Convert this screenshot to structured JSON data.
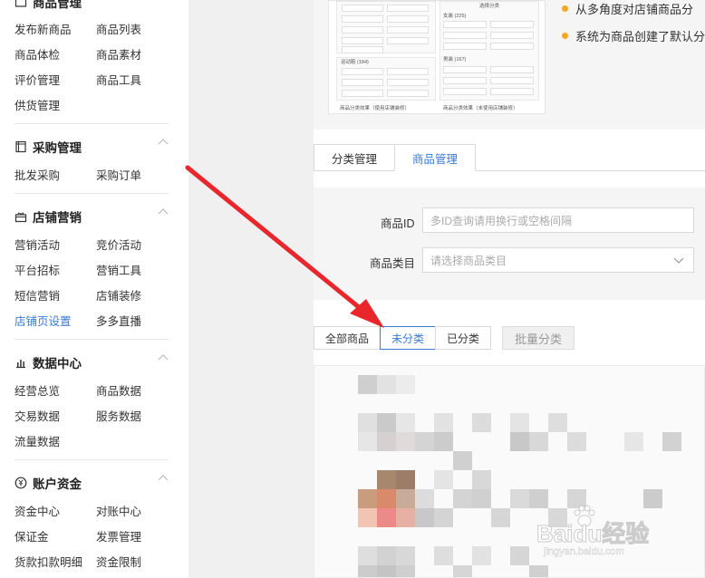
{
  "sidebar": {
    "goods": {
      "title": "商品管理",
      "items": [
        "发布新商品",
        "商品列表",
        "商品体检",
        "商品素材",
        "评价管理",
        "商品工具",
        "供货管理"
      ]
    },
    "purchase": {
      "title": "采购管理",
      "items": [
        "批发采购",
        "采购订单"
      ]
    },
    "marketing": {
      "title": "店铺营销",
      "items": [
        "营销活动",
        "竞价活动",
        "平台招标",
        "营销工具",
        "短信营销",
        "店铺装修",
        "店铺页设置",
        "多多直播"
      ],
      "active": "店铺页设置"
    },
    "data": {
      "title": "数据中心",
      "items": [
        "经营总览",
        "商品数据",
        "交易数据",
        "服务数据",
        "流量数据"
      ]
    },
    "finance": {
      "title": "账户资金",
      "items": [
        "资金中心",
        "对账中心",
        "保证金",
        "发票管理",
        "货款扣款明细",
        "资金限制"
      ]
    }
  },
  "preview": {
    "left_caption": "商品分类效果（使用店铺装修）",
    "right_caption": "商品分类效果（未使用店铺装修）",
    "right_top_label": "选择分类",
    "group1": "女装 (225)",
    "group2": "男装 (167)",
    "group3": "运动鞋 (184)"
  },
  "bullets": [
    "从多角度对店铺商品分",
    "系统为商品创建了默认分"
  ],
  "tabs": {
    "category": "分类管理",
    "goods": "商品管理"
  },
  "form": {
    "id_label": "商品ID",
    "id_placeholder": "多ID查询请用换行或空格间隔",
    "category_label": "商品类目",
    "category_placeholder": "请选择商品类目"
  },
  "filters": {
    "all": "全部商品",
    "uncategorized": "未分类",
    "categorized": "已分类",
    "batch": "批量分类"
  },
  "watermark": {
    "logo": "Baidu经验",
    "url": "jingyan.baidu.com"
  },
  "colors": {
    "accent": "#3a7bd5",
    "arrow": "#e8262b",
    "bullet": "#f5a623"
  }
}
